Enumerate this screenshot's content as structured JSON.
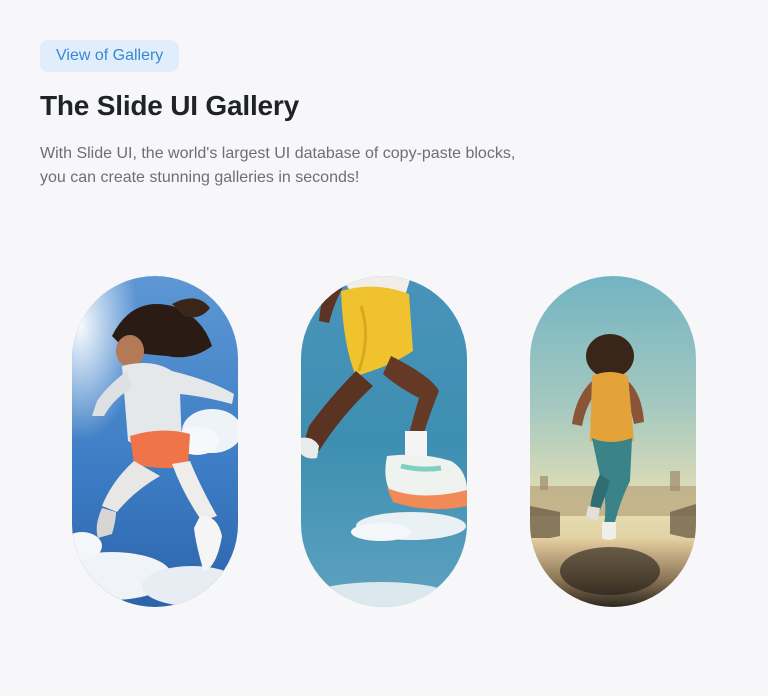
{
  "header": {
    "badge_label": "View of Gallery",
    "title": "The Slide UI Gallery",
    "description_line1": "With Slide UI, the world's largest UI database of copy-paste blocks,",
    "description_line2": "you can create stunning galleries in seconds!"
  },
  "gallery": {
    "images": [
      {
        "subject": "woman-jumping-in-sky"
      },
      {
        "subject": "runner-legs-yellow-shorts"
      },
      {
        "subject": "woman-running-sunset-track"
      }
    ]
  },
  "colors": {
    "background": "#f7f7f9",
    "badge_bg": "#e0eefc",
    "badge_text": "#3b86d4",
    "title": "#1f2328",
    "description": "#6b6f76"
  }
}
